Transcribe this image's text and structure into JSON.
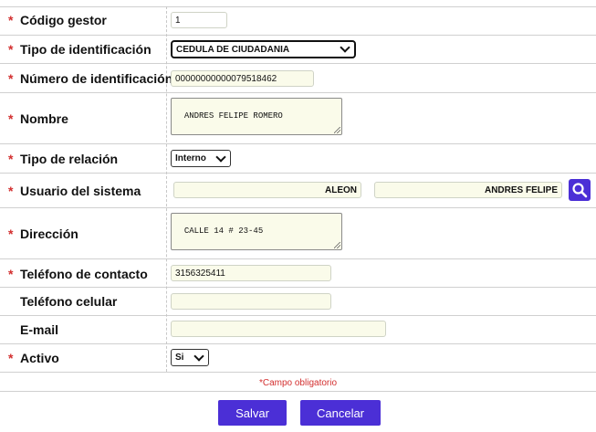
{
  "form": {
    "required_marker": "*",
    "fields": [
      {
        "label": "Código gestor",
        "value": "1",
        "required": true
      },
      {
        "label": "Tipo de identificación",
        "value": "CEDULA DE CIUDADANIA",
        "required": true
      },
      {
        "label": "Número de identificación",
        "value": "00000000000079518462",
        "required": true
      },
      {
        "label": "Nombre",
        "value": "ANDRES FELIPE ROMERO",
        "required": true
      },
      {
        "label": "Tipo de relación",
        "value": "Interno",
        "required": true
      },
      {
        "label": "Usuario del sistema",
        "value": "ALEON",
        "value2": "ANDRES FELIPE",
        "required": true
      },
      {
        "label": "Dirección",
        "value": "CALLE 14 # 23-45",
        "required": true
      },
      {
        "label": "Teléfono de contacto",
        "value": "3156325411",
        "required": true
      },
      {
        "label": "Teléfono celular",
        "value": "",
        "required": false
      },
      {
        "label": "E-mail",
        "value": "",
        "required": false
      },
      {
        "label": "Activo",
        "value": "Si",
        "required": true
      }
    ],
    "mandatory_note": "Campo obligatorio"
  },
  "buttons": {
    "save": "Salvar",
    "cancel": "Cancelar"
  },
  "icons": {
    "search": "search-icon",
    "dropdown": "chevron-down-icon"
  },
  "colors": {
    "accent": "#4b2fd6",
    "required": "#d32f2f",
    "field_bg": "#fafbea"
  }
}
